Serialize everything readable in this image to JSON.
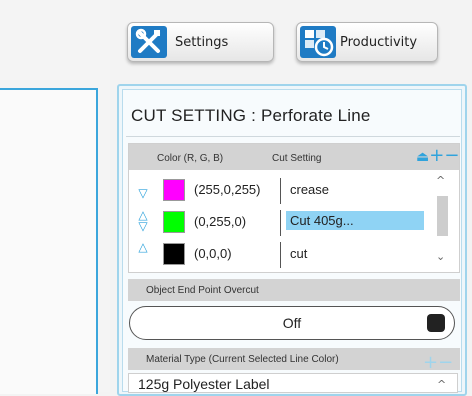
{
  "toolbar": {
    "settings_label": "Settings",
    "productivity_label": "Productivity"
  },
  "panel": {
    "title": "CUT SETTING : Perforate Line",
    "columns": {
      "color": "Color (R, G, B)",
      "cut_setting": "Cut Setting"
    },
    "rows": [
      {
        "color": "#ff00ff",
        "rgb": "(255,0,255)",
        "cut": "crease",
        "selected": false,
        "arrows": "down"
      },
      {
        "color": "#00ff00",
        "rgb": "(0,255,0)",
        "cut": "Cut 405g...",
        "selected": true,
        "arrows": "both"
      },
      {
        "color": "#000000",
        "rgb": "(0,0,0)",
        "cut": "cut",
        "selected": false,
        "arrows": "up"
      }
    ],
    "overcut_label": "Object End Point Overcut",
    "overcut_value": "Off",
    "material_label": "Material Type (Current Selected Line Color)",
    "material_value": "125g Polyester Label"
  },
  "colors": {
    "accent": "#2fa3dc",
    "selection": "#8fd3f4",
    "header_bg": "#d3d3d3"
  }
}
